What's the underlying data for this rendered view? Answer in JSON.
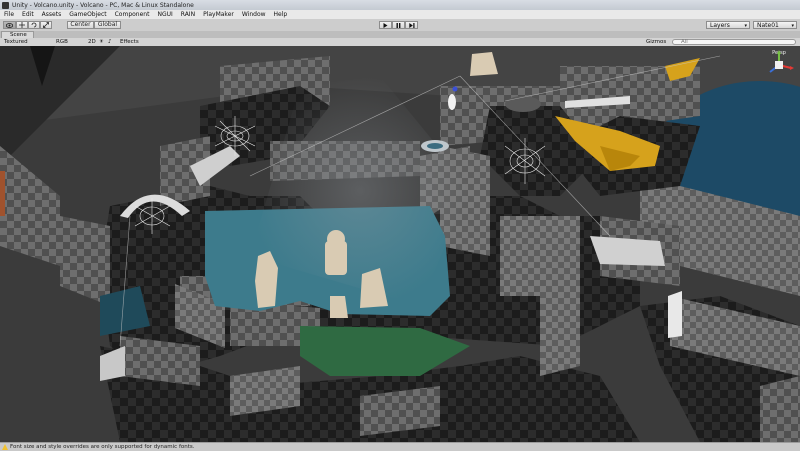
{
  "window": {
    "title": "Unity - Volcano.unity - Volcano - PC, Mac & Linux Standalone"
  },
  "menu": [
    "File",
    "Edit",
    "Assets",
    "GameObject",
    "Component",
    "NGUI",
    "RAIN",
    "PlayMaker",
    "Window",
    "Help"
  ],
  "toolbar": {
    "center_label": "Center",
    "global_label": "Global",
    "layers_label": "Layers",
    "layout_label": "Nate01"
  },
  "scene_tab": {
    "label": "Scene"
  },
  "scene_options": {
    "render_mode": "Textured",
    "color_mode": "RGB",
    "mode_2d": "2D",
    "effects": "Effects",
    "gizmos": "Gizmos",
    "search_placeholder": "All"
  },
  "gizmo": {
    "projection_label": "Persp"
  },
  "status": {
    "message": "Font size and style overrides are only supported for dynamic fonts."
  },
  "colors": {
    "accent_gold": "#d6a21c",
    "lava_pool": "#1d4a66",
    "water": "#3d7b8c"
  }
}
